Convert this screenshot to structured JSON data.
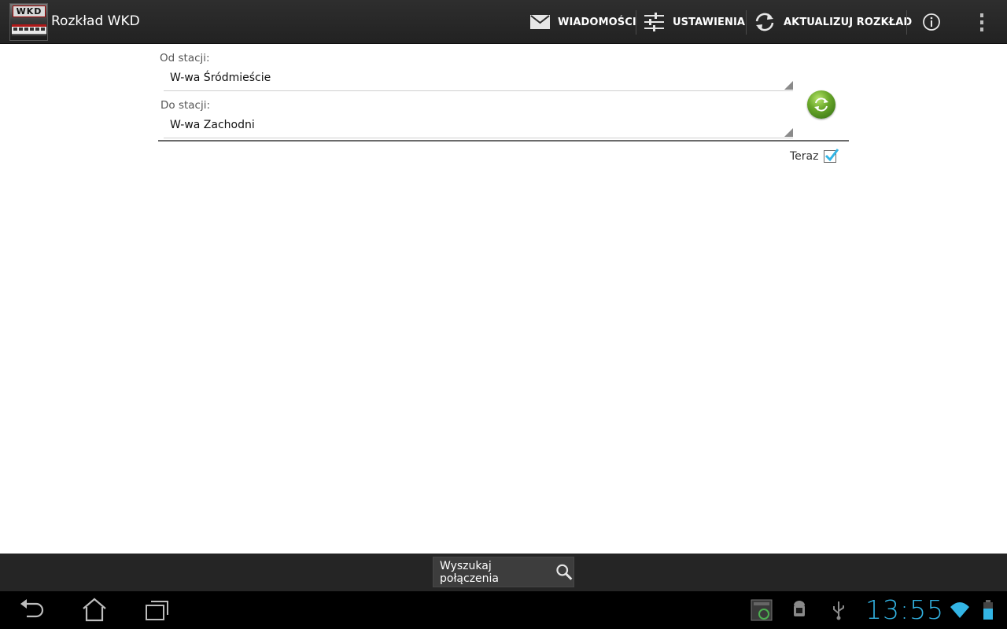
{
  "action_bar": {
    "title": "Rozkład WKD",
    "logo_text": "WKD",
    "actions": [
      {
        "label": "WIADOMOŚCI",
        "icon": "envelope-icon"
      },
      {
        "label": "USTAWIENIA",
        "icon": "sliders-icon"
      },
      {
        "label": "AKTUALIZUJ ROZKŁAD",
        "icon": "refresh-icon"
      }
    ],
    "info_icon": "info-icon",
    "overflow_icon": "overflow-menu-icon"
  },
  "form": {
    "from_label": "Od stacji:",
    "from_value": "W-wa Śródmieście",
    "to_label": "Do stacji:",
    "to_value": "W-wa Zachodni",
    "swap_icon": "swap-stations-icon",
    "now_label": "Teraz",
    "now_checked": true
  },
  "bottom": {
    "search_label": "Wyszukaj połączenia",
    "search_icon": "search-icon"
  },
  "system_bar": {
    "nav": [
      "back-icon",
      "home-icon",
      "recent-apps-icon"
    ],
    "status_icons": [
      "screenshot-notification-icon",
      "android-debug-icon",
      "usb-icon",
      "wifi-icon",
      "battery-icon"
    ],
    "time": "13:55",
    "accent_color": "#33b5e5"
  }
}
